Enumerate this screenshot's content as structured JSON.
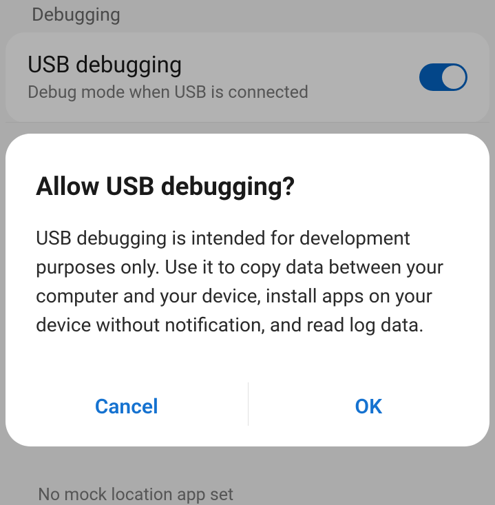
{
  "settings": {
    "section_header": "Debugging",
    "usb_debugging": {
      "title": "USB debugging",
      "subtitle": "Debug mode when USB is connected",
      "enabled": true
    },
    "partial_row_text": "No mock location app set"
  },
  "dialog": {
    "title": "Allow USB debugging?",
    "body": "USB debugging is intended for development purposes only. Use it to copy data between your computer and your device, install apps on your device without notification, and read log data.",
    "cancel": "Cancel",
    "ok": "OK"
  }
}
